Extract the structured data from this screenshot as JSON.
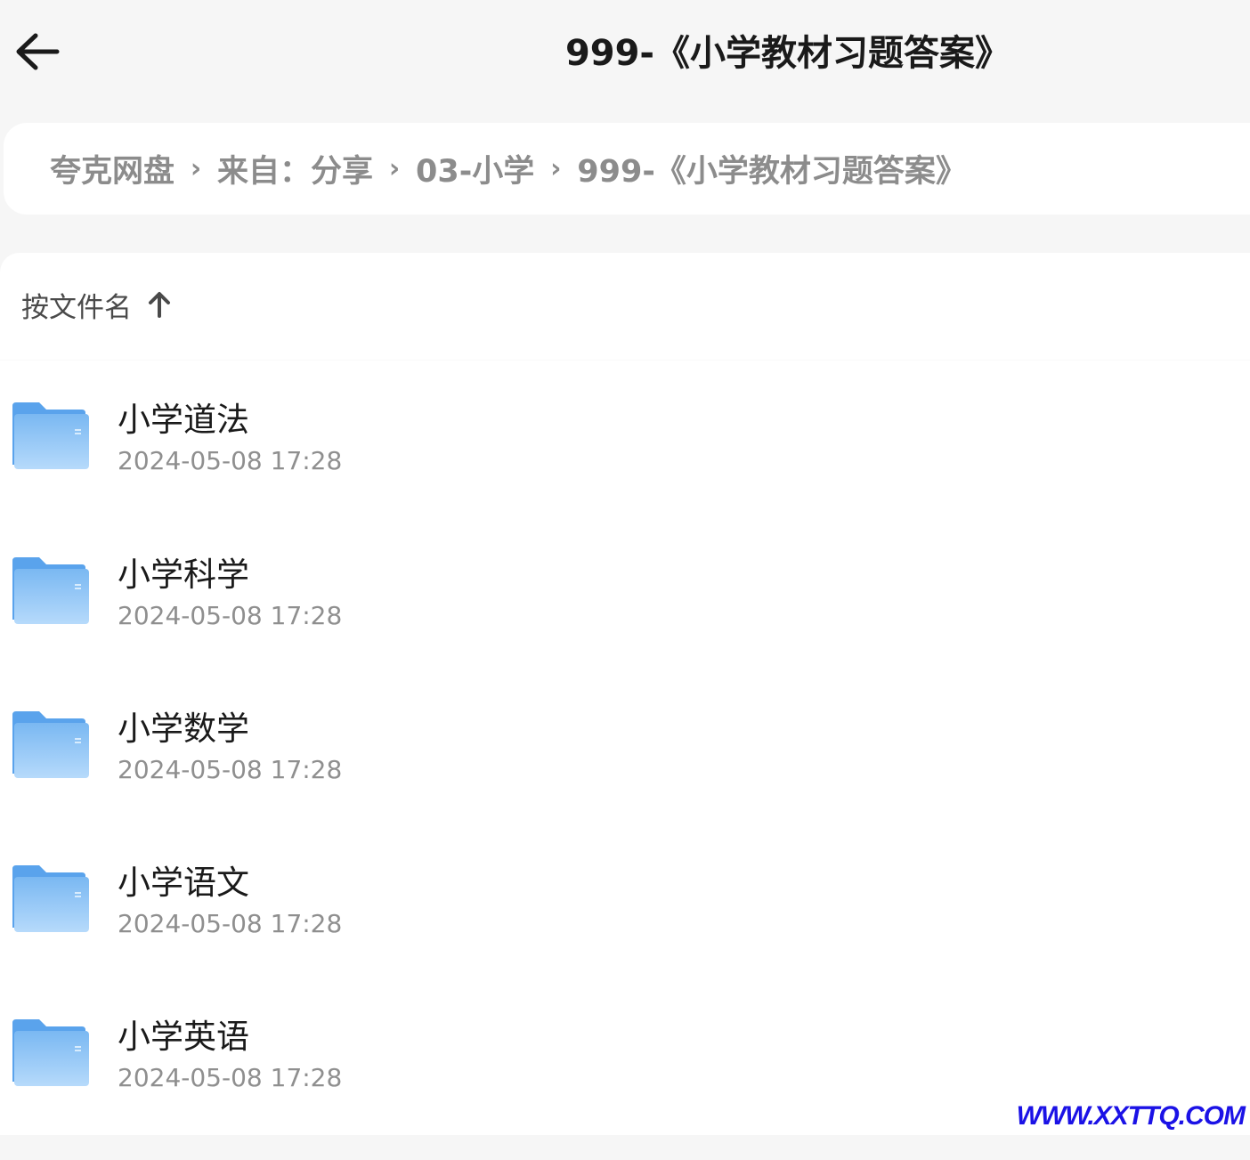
{
  "header": {
    "back_icon": "arrow-left-icon",
    "title": "999-《小学教材习题答案》"
  },
  "breadcrumb": {
    "items": [
      "夸克网盘",
      "来自：分享",
      "03-小学",
      "999-《小学教材习题答案》"
    ],
    "separator": "›"
  },
  "sort": {
    "label": "按文件名",
    "icon": "arrow-up-icon"
  },
  "files": [
    {
      "name": "小学道法",
      "date": "2024-05-08 17:28",
      "icon": "folder-icon"
    },
    {
      "name": "小学科学",
      "date": "2024-05-08 17:28",
      "icon": "folder-icon"
    },
    {
      "name": "小学数学",
      "date": "2024-05-08 17:28",
      "icon": "folder-icon"
    },
    {
      "name": "小学语文",
      "date": "2024-05-08 17:28",
      "icon": "folder-icon"
    },
    {
      "name": "小学英语",
      "date": "2024-05-08 17:28",
      "icon": "folder-icon"
    }
  ],
  "watermark": "WWW.XXTTQ.COM",
  "colors": {
    "background": "#f6f6f6",
    "folder": "#6aaef0",
    "text_primary": "#1a1a1a",
    "text_secondary": "#8f8f8f",
    "watermark": "#1b12e6"
  }
}
